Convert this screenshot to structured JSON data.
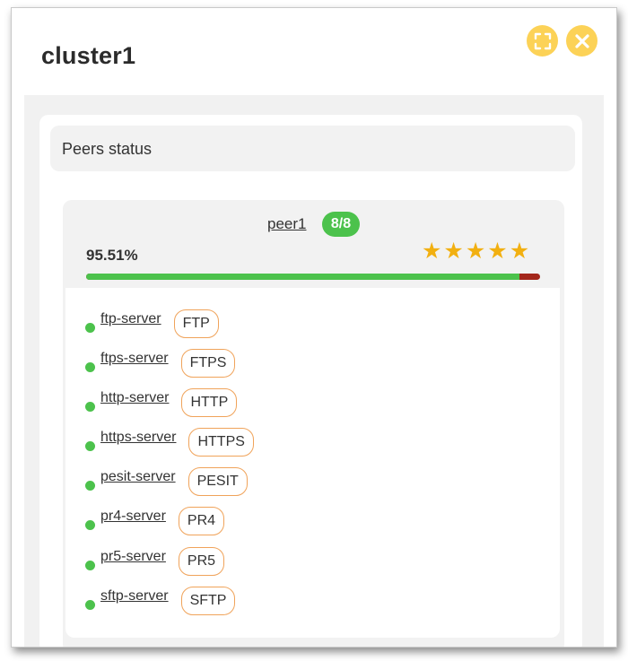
{
  "window": {
    "title": "cluster1",
    "expand_icon": "expand-icon",
    "close_icon": "close-icon",
    "accent_color": "#fcd257"
  },
  "panel": {
    "header": "Peers status"
  },
  "peer": {
    "name": "peer1",
    "badge": "8/8",
    "percent": "95.51%",
    "progress_fraction": 0.9551,
    "rating_stars": 5,
    "star_glyph": "★",
    "colors": {
      "ok": "#4cc24c",
      "error": "#a3271b",
      "star": "#f2b011",
      "protocol_border": "#f0a35a"
    }
  },
  "servers": [
    {
      "name": "ftp-server",
      "protocol": "FTP"
    },
    {
      "name": "ftps-server",
      "protocol": "FTPS"
    },
    {
      "name": "http-server",
      "protocol": "HTTP"
    },
    {
      "name": "https-server",
      "protocol": "HTTPS"
    },
    {
      "name": "pesit-server",
      "protocol": "PESIT"
    },
    {
      "name": "pr4-server",
      "protocol": "PR4"
    },
    {
      "name": "pr5-server",
      "protocol": "PR5"
    },
    {
      "name": "sftp-server",
      "protocol": "SFTP"
    }
  ]
}
